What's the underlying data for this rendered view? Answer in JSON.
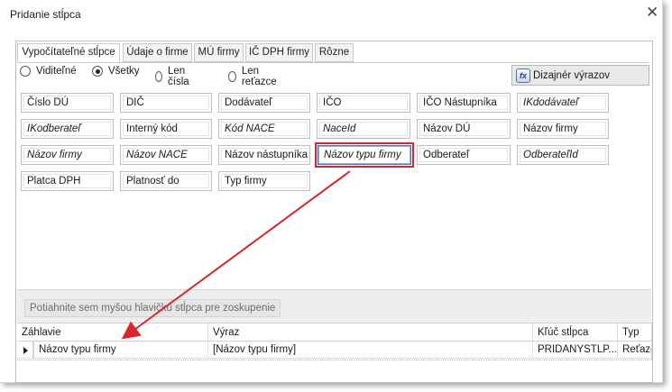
{
  "window": {
    "title": "Pridanie stĺpca",
    "close_glyph": "✕"
  },
  "tabs": [
    {
      "label": "Vypočítateľné stĺpce",
      "active": true
    },
    {
      "label": "Údaje o firme",
      "active": false
    },
    {
      "label": "MÚ firmy",
      "active": false
    },
    {
      "label": "IČ DPH firmy",
      "active": false
    },
    {
      "label": "Rôzne",
      "active": false
    }
  ],
  "filters": {
    "options": [
      {
        "label": "Viditeľné",
        "checked": false
      },
      {
        "label": "Všetky",
        "checked": true
      },
      {
        "label": "Len čísla",
        "checked": false
      },
      {
        "label": "Len reťazce",
        "checked": false
      }
    ]
  },
  "designer_button": {
    "label": "Dizajnér výrazov",
    "icon": "fx-icon"
  },
  "columns": [
    [
      {
        "label": "Číslo DÚ",
        "italic": false
      },
      {
        "label": "DIČ",
        "italic": false
      },
      {
        "label": "Dodávateľ",
        "italic": false
      },
      {
        "label": "IČO",
        "italic": false
      },
      {
        "label": "IČO Nástupníka",
        "italic": false
      },
      {
        "label": "IKdodávateľ",
        "italic": true
      }
    ],
    [
      {
        "label": "IKodberateľ",
        "italic": true
      },
      {
        "label": "Interný kód",
        "italic": false
      },
      {
        "label": "Kód NACE",
        "italic": true
      },
      {
        "label": "NaceId",
        "italic": true
      },
      {
        "label": "Názov DÚ",
        "italic": false
      },
      {
        "label": "Názov firmy",
        "italic": false
      }
    ],
    [
      {
        "label": "Názov firmy",
        "italic": true
      },
      {
        "label": "Názov NACE",
        "italic": true
      },
      {
        "label": "Názov nástupníka",
        "italic": false
      },
      {
        "label": "Názov typu firmy",
        "italic": true,
        "selected": true
      },
      {
        "label": "Odberateľ",
        "italic": false
      },
      {
        "label": "OdberateľId",
        "italic": true
      }
    ],
    [
      {
        "label": "Platca DPH",
        "italic": false
      },
      {
        "label": "Platnosť do",
        "italic": false
      },
      {
        "label": "Typ firmy",
        "italic": false
      }
    ]
  ],
  "group_area": {
    "hint": "Potiahnite sem myšou hlavičku stĺpca pre zoskupenie"
  },
  "grid": {
    "headers": [
      "Záhlavie",
      "Výraz",
      "Kľúč stĺpca",
      "Typ"
    ],
    "rows": [
      [
        "Názov typu firmy",
        "[Názov typu firmy]",
        "PRIDANYSTLP...",
        "Reťaze"
      ]
    ]
  },
  "colors": {
    "highlight": "#d8262c",
    "arrow": "#d8262c"
  }
}
